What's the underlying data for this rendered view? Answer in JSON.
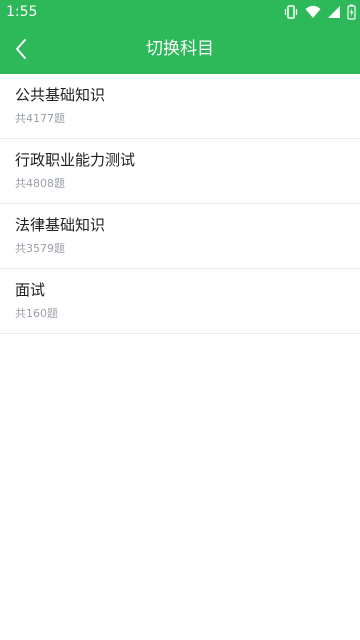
{
  "status_bar": {
    "time": "1:55",
    "icons": [
      "vibrate-icon",
      "wifi-icon",
      "signal-icon",
      "battery-icon"
    ]
  },
  "header": {
    "title": "切换科目",
    "back_icon": "chevron-left-icon"
  },
  "subjects": [
    {
      "name": "公共基础知识",
      "count": "共4177题"
    },
    {
      "name": "行政职业能力测试",
      "count": "共4808题"
    },
    {
      "name": "法律基础知识",
      "count": "共3579题"
    },
    {
      "name": "面试",
      "count": "共160题"
    }
  ],
  "colors": {
    "brand": "#2db85a",
    "text_primary": "#222222",
    "text_secondary": "#9aa0a8",
    "divider": "#e8e8e8"
  }
}
